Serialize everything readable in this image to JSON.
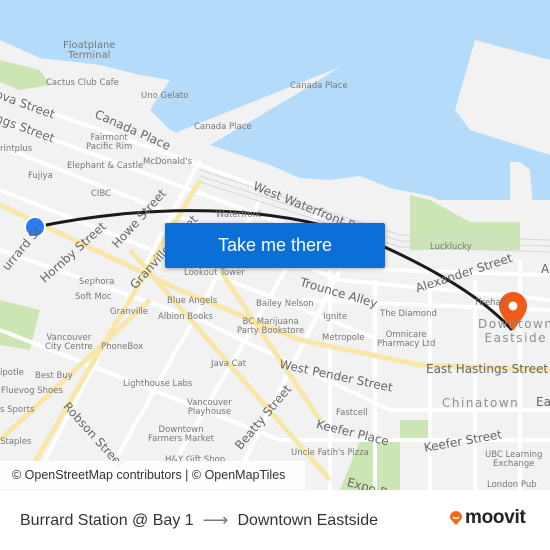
{
  "map": {
    "water_color": "#b4dcfa",
    "land_color": "#f2f2f2",
    "park_color": "#cbe6b4",
    "major_road_color": "#f7e7a8",
    "route_color": "#1a1a1a",
    "origin_marker_color": "#2b7bf3",
    "destination_marker_color": "#f05a16",
    "labels": {
      "floatplane": "Floatplane\nTerminal",
      "cactus_club": "Cactus Club Cafe",
      "uno_gelato": "Uno Gelato",
      "canada_place_pier": "Canada Place",
      "canada_place_poi": "Canada Place",
      "canada_place_street": "Canada Place",
      "cordova_street": "ova Street",
      "hastings_street": "ngs Street",
      "printplus": "rintplus",
      "fairmont": "Fairmont\nPacific Rim",
      "elephant_castle": "Elephant & Castle",
      "mcdonalds": "McDonald's",
      "fujiya": "Fujiya",
      "cibc": "CIBC",
      "west_waterfront": "West Waterfront Road",
      "waterfront": "Waterfront",
      "burrard_street": "urrard St",
      "hornby_street": "Hornby Street",
      "howe_street": "Howe Street",
      "granville_street": "Granville Street",
      "lookout_tower": "Lookout Tower",
      "lucklucky": "Lucklucky",
      "alexander_street": "Alexander Street",
      "a_street": "A",
      "trounce_alley": "Trounce Alley",
      "sephora": "Sephora",
      "soft_moc": "Soft Moc",
      "granville": "Granville",
      "blue_angels": "Blue Angels",
      "albion_books": "Albion Books",
      "bailey_nelson": "Bailey Nelson",
      "ignite": "Ignite",
      "the_diamond": "The Diamond",
      "firehall": "Firehall",
      "bc_marijuana": "BC Marijuana\nParty Bookstore",
      "metropole": "Metropole",
      "omnicare": "Omnicare\nPharmacy Ltd",
      "downtown_eastside": "Downtown\nEastside",
      "vancouver_city_centre": "Vancouver\nCity Centre",
      "phonebox": "PhoneBox",
      "java_cat": "Java Cat",
      "chipotle": "ipotle",
      "best_buy": "Best Buy",
      "fluevog": "Fluevog Shoes",
      "sports": "s Sports",
      "staples": "Staples",
      "lighthouse_labs": "Lighthouse Labs",
      "robson_street": "Robson Street",
      "vancouver_playhouse": "Vancouver\nPlayhouse",
      "beatty_street": "Beatty Street",
      "farmers_market": "Downtown\nFarmers Market",
      "hy_gift_shop": "H&Y Gift Shop",
      "west_pender": "West Pender Street",
      "east_hastings": "East Hastings Street",
      "chinatown": "Chinatown",
      "ea_street": "Ea",
      "fastcell": "Fastcell",
      "keefer_place": "Keefer Place",
      "keefer_street": "Keefer Street",
      "uncle_faths": "Uncle Fatih's Pizza",
      "ubc_learning": "UBC Learning\nExchange",
      "expo": "Expo B",
      "london_pub": "London Pub"
    }
  },
  "cta": {
    "label": "Take me there"
  },
  "attribution": "© OpenStreetMap contributors | © OpenMapTiles",
  "footer": {
    "origin": "Burrard Station @ Bay 1",
    "arrow": "⟶",
    "destination": "Downtown Eastside",
    "brand": "moovit"
  }
}
